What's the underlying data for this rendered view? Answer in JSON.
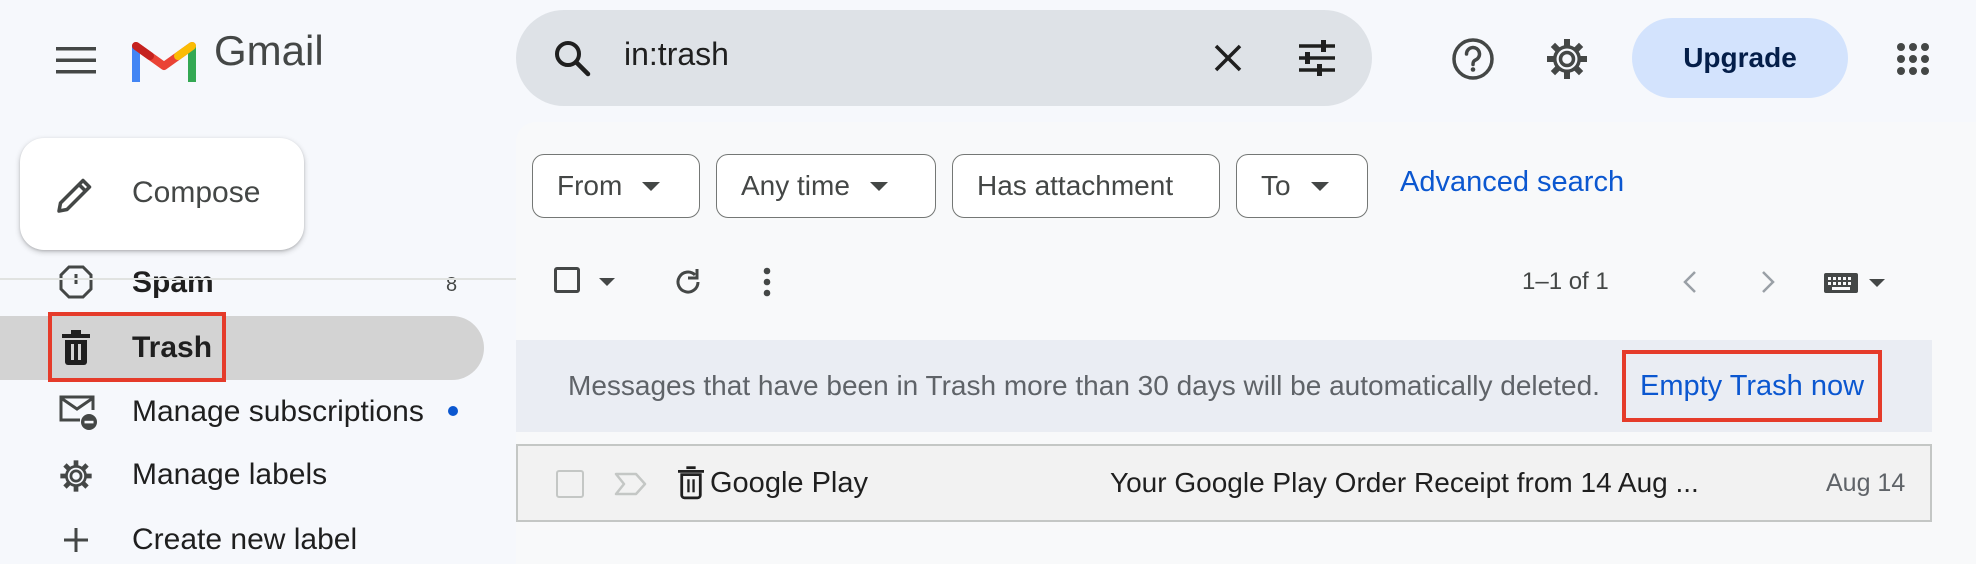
{
  "app": {
    "title": "Gmail"
  },
  "search": {
    "query": "in:trash"
  },
  "header": {
    "upgrade_label": "Upgrade"
  },
  "sidebar": {
    "compose_label": "Compose",
    "items": [
      {
        "label": "Spam",
        "count": "8"
      },
      {
        "label": "Trash"
      },
      {
        "label": "Manage subscriptions"
      },
      {
        "label": "Manage labels"
      },
      {
        "label": "Create new label"
      }
    ]
  },
  "filters": {
    "chips": [
      "From",
      "Any time",
      "Has attachment",
      "To"
    ],
    "advanced_search_label": "Advanced search"
  },
  "toolbar": {
    "page_count": "1–1 of 1"
  },
  "banner": {
    "message": "Messages that have been in Trash more than 30 days will be automatically deleted.",
    "action_label": "Empty Trash now"
  },
  "emails": [
    {
      "sender": "Google Play",
      "subject": "Your Google Play Order Receipt from 14 Aug ...",
      "date": "Aug 14"
    }
  ],
  "colors": {
    "accent_blue": "#0b57d0",
    "highlight_red": "#e53b2a",
    "upgrade_bg": "#d3e3fd",
    "unread_dot": "#0b57d0"
  }
}
